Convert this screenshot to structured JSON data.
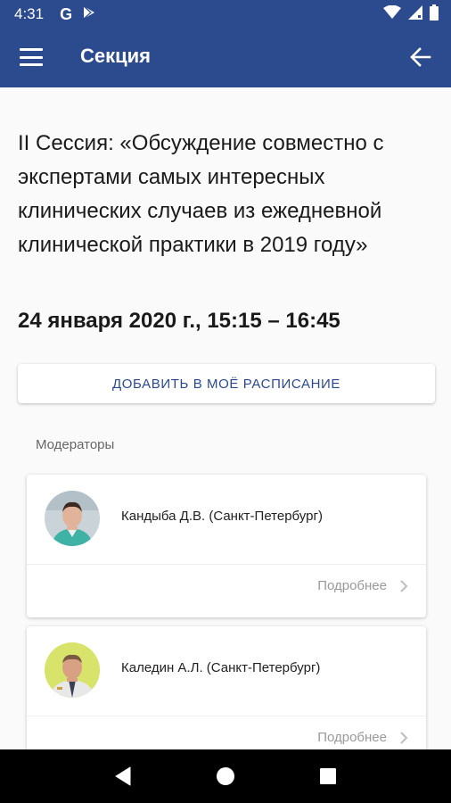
{
  "status_bar": {
    "time": "4:31",
    "g_label": "G"
  },
  "toolbar": {
    "title": "Секция"
  },
  "session": {
    "title": "II Сессия: «Обсуждение совместно с экспертами самых интересных клинических случаев из ежедневной клинической практики в 2019 году»",
    "time": "24 января 2020 г., 15:15 – 16:45"
  },
  "add_button": {
    "label": "ДОБАВИТЬ В МОЁ РАСПИСАНИЕ"
  },
  "moderators": {
    "section_label": "Модераторы",
    "items": [
      {
        "name": "Кандыба Д.В. (Санкт-Петербург)",
        "more_label": "Подробнее"
      },
      {
        "name": "Каледин А.Л. (Санкт-Петербург)",
        "more_label": "Подробнее"
      }
    ]
  },
  "colors": {
    "primary": "#2c4a8e",
    "background": "#fafafa"
  }
}
